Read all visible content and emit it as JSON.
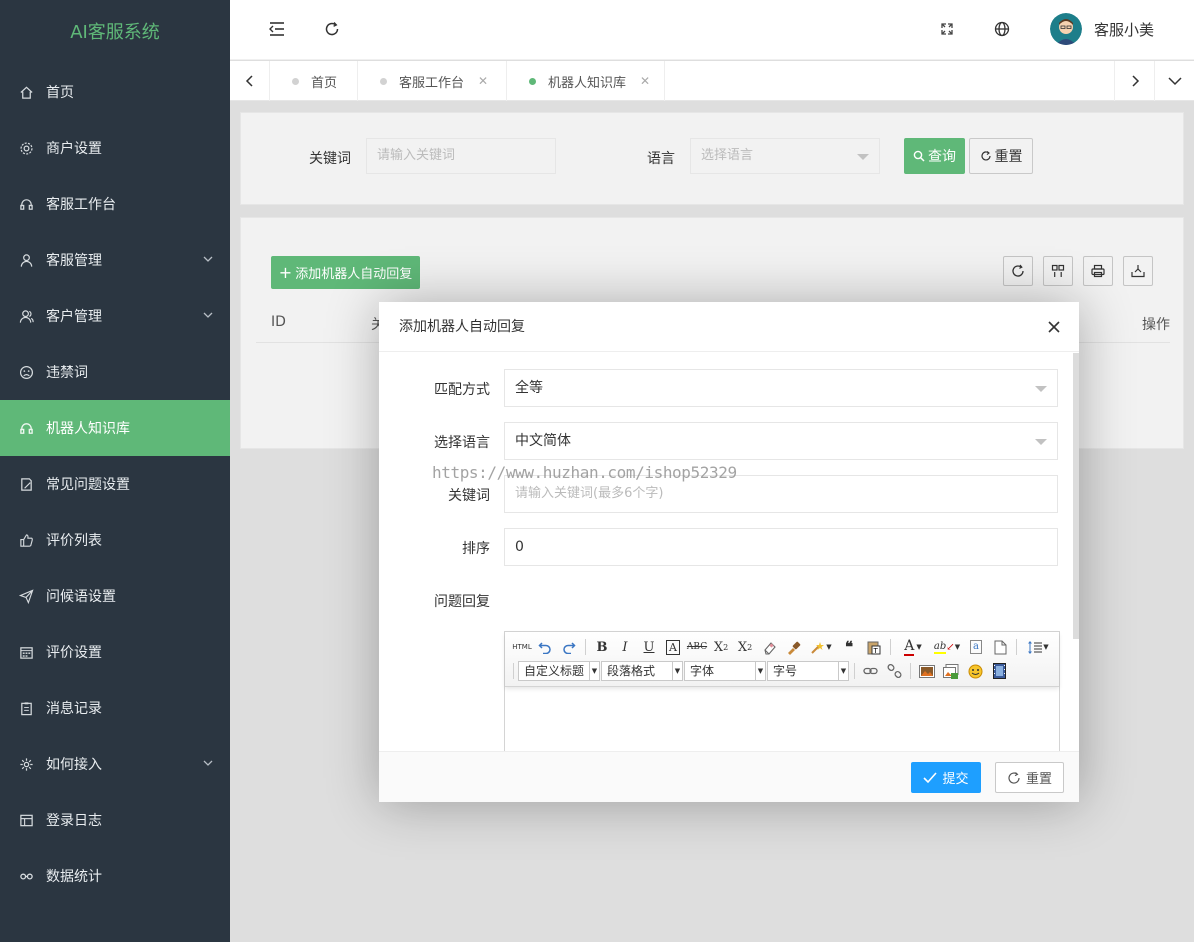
{
  "app": {
    "title": "AI客服系统"
  },
  "sidebar": {
    "items": [
      {
        "label": "首页",
        "icon": "home-icon"
      },
      {
        "label": "商户设置",
        "icon": "gear-icon"
      },
      {
        "label": "客服工作台",
        "icon": "headset-icon"
      },
      {
        "label": "客服管理",
        "icon": "user-icon",
        "expandable": true
      },
      {
        "label": "客户管理",
        "icon": "users-icon",
        "expandable": true
      },
      {
        "label": "违禁词",
        "icon": "frown-icon"
      },
      {
        "label": "机器人知识库",
        "icon": "robot-icon",
        "active": true
      },
      {
        "label": "常见问题设置",
        "icon": "faq-icon"
      },
      {
        "label": "评价列表",
        "icon": "thumb-up-icon"
      },
      {
        "label": "问候语设置",
        "icon": "send-icon"
      },
      {
        "label": "评价设置",
        "icon": "calendar-icon"
      },
      {
        "label": "消息记录",
        "icon": "clipboard-icon"
      },
      {
        "label": "如何接入",
        "icon": "cog-icon",
        "expandable": true
      },
      {
        "label": "登录日志",
        "icon": "log-icon"
      },
      {
        "label": "数据统计",
        "icon": "chart-icon"
      }
    ]
  },
  "header": {
    "user_name": "客服小美"
  },
  "tabs": [
    {
      "label": "首页",
      "closable": false,
      "active": false
    },
    {
      "label": "客服工作台",
      "closable": true,
      "active": false
    },
    {
      "label": "机器人知识库",
      "closable": true,
      "active": true
    }
  ],
  "search": {
    "keyword_label": "关键词",
    "keyword_placeholder": "请输入关键词",
    "language_label": "语言",
    "language_placeholder": "选择语言",
    "query_button": "查询",
    "reset_button": "重置"
  },
  "table": {
    "add_button": "添加机器人自动回复",
    "columns": [
      "ID",
      "关",
      "操作"
    ]
  },
  "modal": {
    "title": "添加机器人自动回复",
    "fields": {
      "match_label": "匹配方式",
      "match_value": "全等",
      "language_label": "选择语言",
      "language_value": "中文简体",
      "keyword_label": "关键词",
      "keyword_placeholder": "请输入关键词(最多6个字)",
      "sort_label": "排序",
      "sort_value": "0",
      "reply_label": "问题回复"
    },
    "editor": {
      "selects": [
        "自定义标题",
        "段落格式",
        "字体",
        "字号"
      ],
      "html_label": "HTML"
    },
    "submit_button": "提交",
    "reset_button": "重置"
  },
  "watermark": "https://www.huzhan.com/ishop52329",
  "colors": {
    "sidebar_bg": "#2b3641",
    "accent_green": "#5fb878",
    "submit_blue": "#1e9fff"
  }
}
